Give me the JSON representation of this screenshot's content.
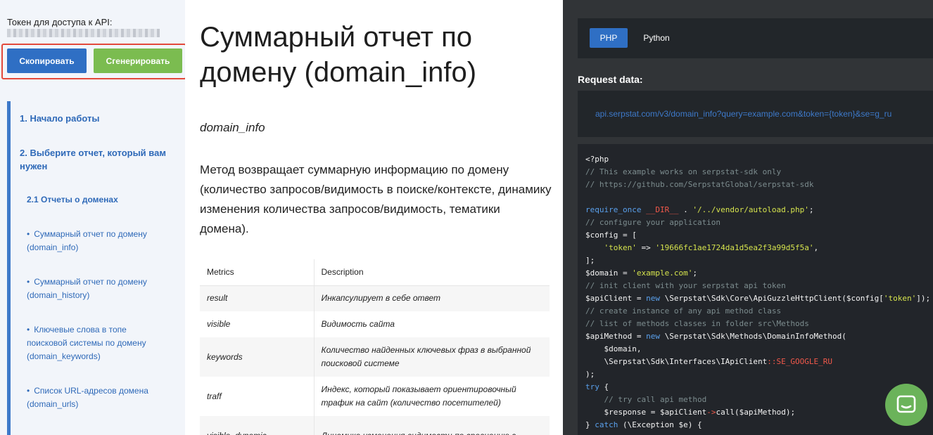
{
  "sidebar": {
    "token_label": "Токен для доступа к API:",
    "copy_button": "Скопировать",
    "generate_button": "Сгенерировать",
    "nav": [
      {
        "label": "1. Начало работы"
      },
      {
        "label": "2. Выберите отчет, который вам нужен"
      },
      {
        "label": "2.1 Отчеты о доменах"
      },
      {
        "label": "Суммарный отчет по домену (domain_info)"
      },
      {
        "label": "Суммарный отчет по домену (domain_history)"
      },
      {
        "label": "Ключевые слова в топе поисковой системы по домену (domain_keywords)"
      },
      {
        "label": "Список URL-адресов домена (domain_urls)"
      }
    ]
  },
  "main": {
    "title": "Суммарный отчет по домену (domain_info)",
    "subtitle": "domain_info",
    "description": "Метод возвращает суммарную информацию по домену (количество запросов/видимость в поиске/контексте, динамику изменения количества запросов/видимость, тематики домена).",
    "table": {
      "headers": [
        "Metrics",
        "Description"
      ],
      "rows": [
        {
          "metric": "result",
          "description": "Инкапсулирует в себе ответ"
        },
        {
          "metric": "visible",
          "description": "Видимость сайта"
        },
        {
          "metric": "keywords",
          "description": "Количество найденных ключевых фраз в выбранной поисковой системе"
        },
        {
          "metric": "traff",
          "description": "Индекс, который показывает ориентировочный трафик на сайт (количество посетителей)"
        },
        {
          "metric": "visible_dynamic",
          "description": "Динамика изменения видимости по сравнению с"
        }
      ]
    }
  },
  "code_panel": {
    "tabs": [
      {
        "label": "PHP"
      },
      {
        "label": "Python"
      }
    ],
    "request_label": "Request data:",
    "request_url": "api.serpstat.com/v3/domain_info?query=example.com&token={token}&se=g_ru",
    "code_tokens": {
      "open_tag": "<?php",
      "c1": "// This example works on serpstat-sdk only",
      "c2": "// https://github.com/SerpstatGlobal/serpstat-sdk",
      "require_once": "require_once",
      "dir_const": "__DIR__",
      "autoload_path": "'/../vendor/autoload.php'",
      "c3": "// configure your application",
      "config_var": "$config",
      "token_key": "'token'",
      "token_value": "'19666fc1ae1724da1d5ea2f3a99d5f5a'",
      "domain_var": "$domain",
      "domain_value": "'example.com'",
      "c4": "// init client with your serpstat api token",
      "api_client_var": "$apiClient",
      "new_kw": "new",
      "client_class": "\\Serpstat\\Sdk\\Core\\ApiGuzzleHttpClient",
      "c5": "// create instance of any api method class",
      "c6": "// list of methods classes in folder src\\Methods",
      "api_method_var": "$apiMethod",
      "method_class": "\\Serpstat\\Sdk\\Methods\\DomainInfoMethod",
      "interface_class": "\\Serpstat\\Sdk\\Interfaces\\IApiClient",
      "se_const": "SE_GOOGLE_RU",
      "try_kw": "try",
      "c7": "// try call api method",
      "response_var": "$response",
      "call_fn": "call",
      "catch_kw": "catch",
      "exception_class": "\\Exception",
      "e_var": "$e"
    }
  }
}
